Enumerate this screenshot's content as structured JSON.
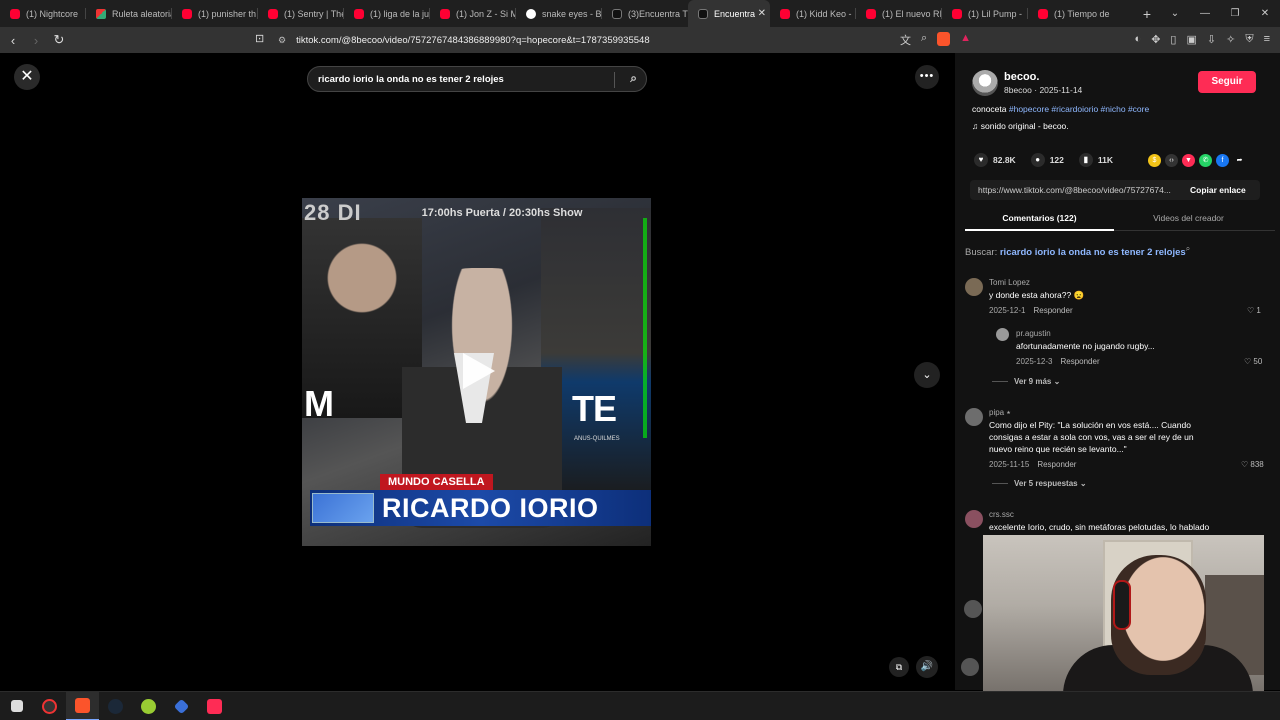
{
  "browser": {
    "tabs": [
      {
        "label": "(1) Nightcore",
        "icon": "youtube-icon"
      },
      {
        "label": "Ruleta aleatoria",
        "icon": "ruleta-icon"
      },
      {
        "label": "(1) punisher th",
        "icon": "youtube-icon"
      },
      {
        "label": "(1) Sentry | The",
        "icon": "youtube-icon"
      },
      {
        "label": "(1) liga de la ju",
        "icon": "youtube-icon"
      },
      {
        "label": "(1) Jon Z - Si M",
        "icon": "youtube-icon"
      },
      {
        "label": "snake eyes - B",
        "icon": "google-icon"
      },
      {
        "label": "(3)Encuentra T",
        "icon": "tiktok-icon"
      },
      {
        "label": "Encuentra",
        "icon": "tiktok-icon",
        "active": true
      },
      {
        "label": "(1) Kidd Keo -",
        "icon": "youtube-icon"
      },
      {
        "label": "(1) El nuevo RI",
        "icon": "youtube-icon"
      },
      {
        "label": "(1) Lil Pump -",
        "icon": "youtube-icon"
      },
      {
        "label": "(1) Tiempo de",
        "icon": "youtube-icon"
      }
    ],
    "url": "tiktok.com/@8becoo/video/7572767484386889980?q=hopecore&t=1787359935548"
  },
  "search": {
    "query": "ricardo iorio la onda no es tener 2 relojes"
  },
  "video": {
    "header_number": "28 DI",
    "header_time": "17:00hs Puerta / 20:30hs Show",
    "side_left": "M",
    "side_right": "TE",
    "side_small": "ANUS-QUILMES",
    "show_label": "MUNDO CASELLA",
    "name_label": "RICARDO IORIO"
  },
  "post": {
    "username": "becoo.",
    "handle_date": "8becoo · 2025-11-14",
    "follow_label": "Seguir",
    "desc_prefix": "conoceta",
    "hashtags": "#hopecore #ricardoiorio #nicho #core",
    "sound": "sonido original - becoo.",
    "likes": "82.8K",
    "comments": "122",
    "saves": "11K",
    "link": "https://www.tiktok.com/@8becoo/video/75727674...",
    "copy_label": "Copiar enlace",
    "tab_comments": "Comentarios (122)",
    "tab_videos": "Videos del creador",
    "buscar_prefix": "Buscar:",
    "buscar_query": "ricardo iorio la onda no es tener 2 relojes"
  },
  "comments": [
    {
      "user": "Tomi Lopez",
      "text": "y donde esta ahora?? 😦",
      "date": "2025-12-1",
      "reply": "Responder",
      "likes": "1"
    },
    {
      "user": "pr.agustin",
      "text": "afortunadamente no jugando rugby...",
      "date": "2025-12-3",
      "reply": "Responder",
      "likes": "50"
    },
    {
      "more": "Ver 9 más"
    },
    {
      "user": "pipa ⭑",
      "text": "Como dijo el Pity: \"La solución en vos está.... Cuando consigas a estar a sola con vos, vas a ser el rey de un nuevo reino que recién se levanto...\"",
      "date": "2025-11-15",
      "reply": "Responder",
      "likes": "838"
    },
    {
      "more": "Ver 5 respuestas"
    },
    {
      "user": "crs.ssc",
      "text": "excelente Iorio, crudo, sin metáforas pelotudas, lo hablado"
    }
  ],
  "colors": {
    "accent": "#fe2c55",
    "link": "#8fb8ff",
    "panel": "#121212"
  }
}
